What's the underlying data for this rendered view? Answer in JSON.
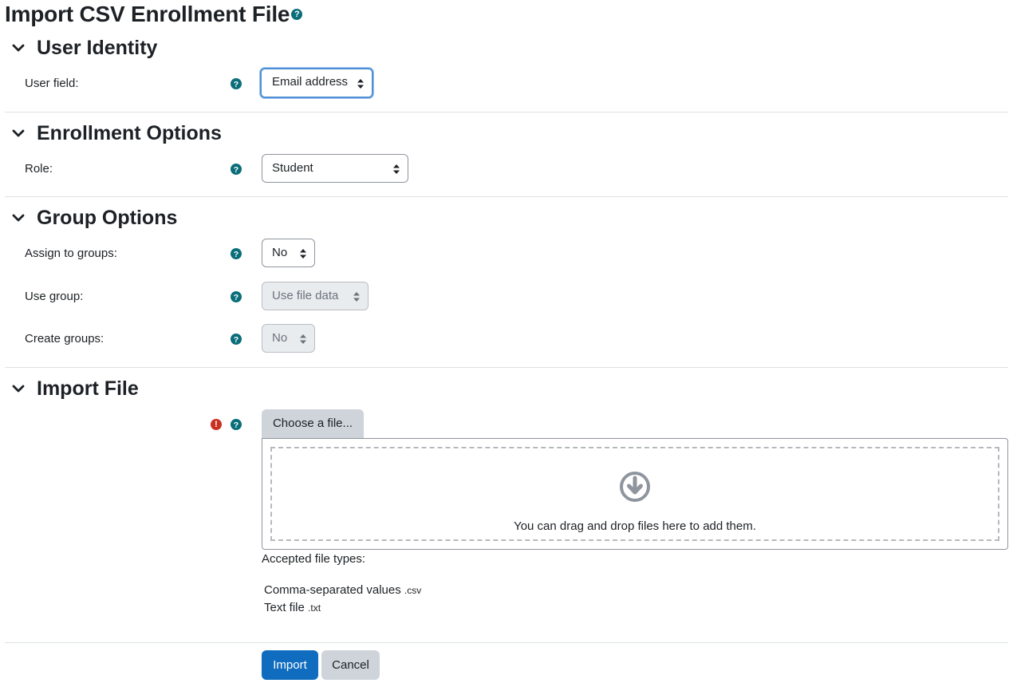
{
  "page": {
    "title": "Import CSV Enrollment File",
    "help_glyph": "?"
  },
  "sections": {
    "user_identity": {
      "heading": "User Identity",
      "fields": {
        "user_field": {
          "label": "User field:",
          "value": "Email address"
        }
      }
    },
    "enrollment_options": {
      "heading": "Enrollment Options",
      "fields": {
        "role": {
          "label": "Role:",
          "value": "Student"
        }
      }
    },
    "group_options": {
      "heading": "Group Options",
      "fields": {
        "assign_to_groups": {
          "label": "Assign to groups:",
          "value": "No"
        },
        "use_group": {
          "label": "Use group:",
          "value": "Use file data",
          "disabled": true
        },
        "create_groups": {
          "label": "Create groups:",
          "value": "No",
          "disabled": true
        }
      }
    },
    "import_file": {
      "heading": "Import File",
      "choose_button": "Choose a file...",
      "dropzone_text": "You can drag and drop files here to add them.",
      "accepted_label": "Accepted file types:",
      "file_types": [
        {
          "name": "Comma-separated values",
          "ext": ".csv"
        },
        {
          "name": "Text file",
          "ext": ".txt"
        }
      ],
      "required_glyph": "!"
    }
  },
  "actions": {
    "import_label": "Import",
    "cancel_label": "Cancel"
  },
  "colors": {
    "primary": "#0f6cbf",
    "help_icon": "#0a6e7a",
    "required_icon": "#ca3120",
    "secondary_button": "#ced4da",
    "focus_ring": "#4f8fd5"
  },
  "icons": {
    "help": "question-circle-icon",
    "collapse": "chevron-down-icon",
    "required": "exclamation-circle-icon",
    "select_arrows": "sort-arrows-icon",
    "dropzone": "arrow-down-circle-icon"
  }
}
